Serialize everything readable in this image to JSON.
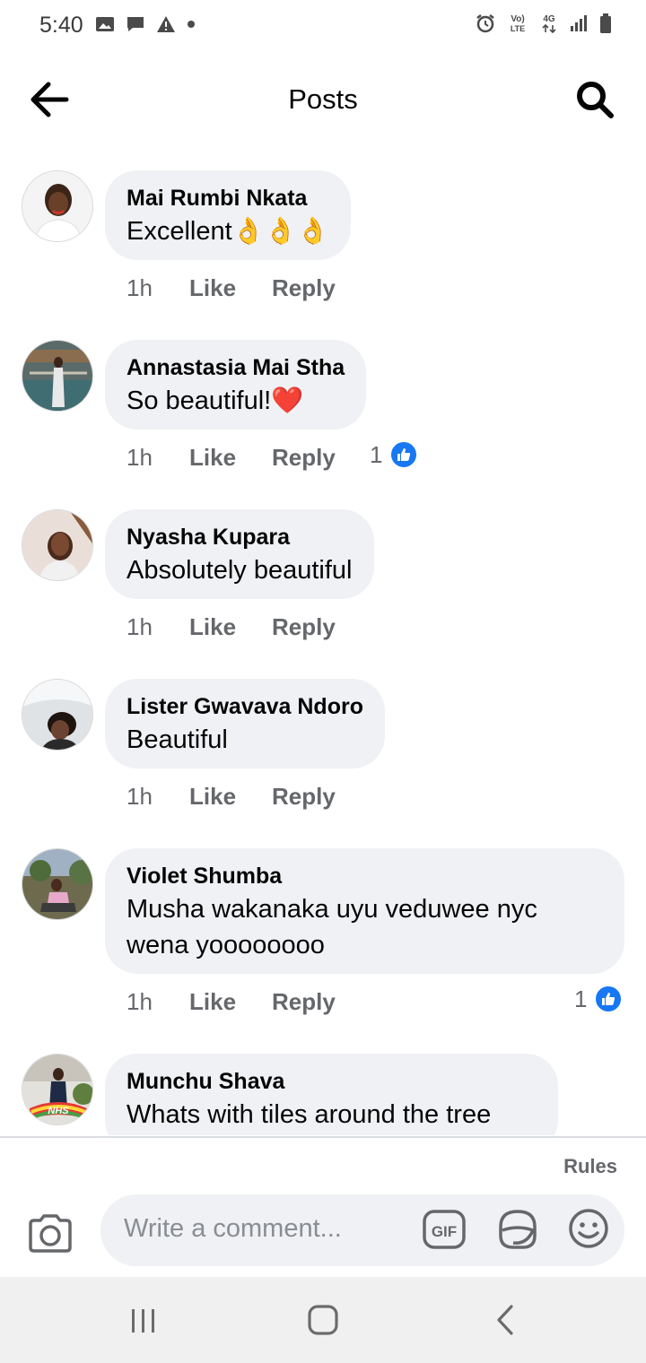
{
  "status_bar": {
    "time": "5:40",
    "left_icons": [
      "image-icon",
      "message-icon",
      "warning-icon",
      "dot-icon"
    ],
    "right_icons": [
      "alarm-icon",
      "volte-icon",
      "4g-data-icon",
      "signal-icon",
      "battery-icon"
    ],
    "volte_label_top": "Vo)",
    "volte_label_bottom": "LTE",
    "network_label": "4G"
  },
  "header": {
    "title": "Posts",
    "back_icon": "arrow-left-icon",
    "search_icon": "search-icon"
  },
  "comments": [
    {
      "author": "Mai Rumbi Nkata",
      "text": "Excellent👌👌👌",
      "time": "1h",
      "like_label": "Like",
      "reply_label": "Reply",
      "reaction_count": ""
    },
    {
      "author": "Annastasia Mai Stha",
      "text": "So beautiful!❤️",
      "time": "1h",
      "like_label": "Like",
      "reply_label": "Reply",
      "reaction_count": "1"
    },
    {
      "author": "Nyasha Kupara",
      "text": "Absolutely beautiful",
      "time": "1h",
      "like_label": "Like",
      "reply_label": "Reply",
      "reaction_count": ""
    },
    {
      "author": "Lister Gwavava Ndoro",
      "text": "Beautiful",
      "time": "1h",
      "like_label": "Like",
      "reply_label": "Reply",
      "reaction_count": ""
    },
    {
      "author": "Violet Shumba",
      "text_line1": "Musha wakanaka uyu veduwee nyc",
      "text_line2": "wena yoooooooo",
      "time": "1h",
      "like_label": "Like",
      "reply_label": "Reply",
      "reaction_count": "1"
    },
    {
      "author": "Munchu Shava",
      "text": "Whats with tiles around the tree",
      "avatar_badge": "NHS"
    }
  ],
  "composer": {
    "rules_label": "Rules",
    "placeholder": "Write a comment...",
    "gif_label": "GIF",
    "camera_icon": "camera-icon",
    "sticker_icon": "sticker-icon",
    "emoji_icon": "emoji-icon"
  },
  "nav_bar": {
    "icons": [
      "recents-icon",
      "home-icon",
      "back-icon"
    ]
  },
  "colors": {
    "bubble": "#eff1f4",
    "secondary_text": "#65676b",
    "like_blue": "#1877f2"
  }
}
